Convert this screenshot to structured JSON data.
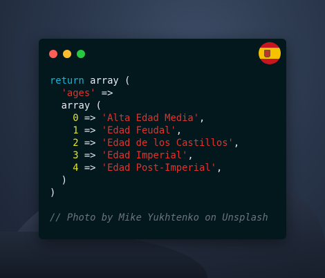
{
  "window": {
    "controls": [
      "close",
      "minimize",
      "maximize"
    ],
    "colors": {
      "close": "#fd5f57",
      "minimize": "#febc2e",
      "maximize": "#28c840"
    },
    "flag_icon": "spain-flag"
  },
  "code": {
    "keyword": "return",
    "array_kw": "array",
    "open": "(",
    "key": "'ages'",
    "arrow": "=>",
    "items": [
      {
        "index": "0",
        "value": "'Alta Edad Media'"
      },
      {
        "index": "1",
        "value": "'Edad Feudal'"
      },
      {
        "index": "2",
        "value": "'Edad de los Castillos'"
      },
      {
        "index": "3",
        "value": "'Edad Imperial'"
      },
      {
        "index": "4",
        "value": "'Edad Post-Imperial'"
      }
    ],
    "close": ")",
    "comment": "// Photo by Mike Yukhtenko on Unsplash"
  },
  "colors": {
    "keyword": "#17b3d4",
    "string": "#e0332f",
    "number": "#e3e81b",
    "comment": "#6b737b",
    "background": "#03181d"
  }
}
